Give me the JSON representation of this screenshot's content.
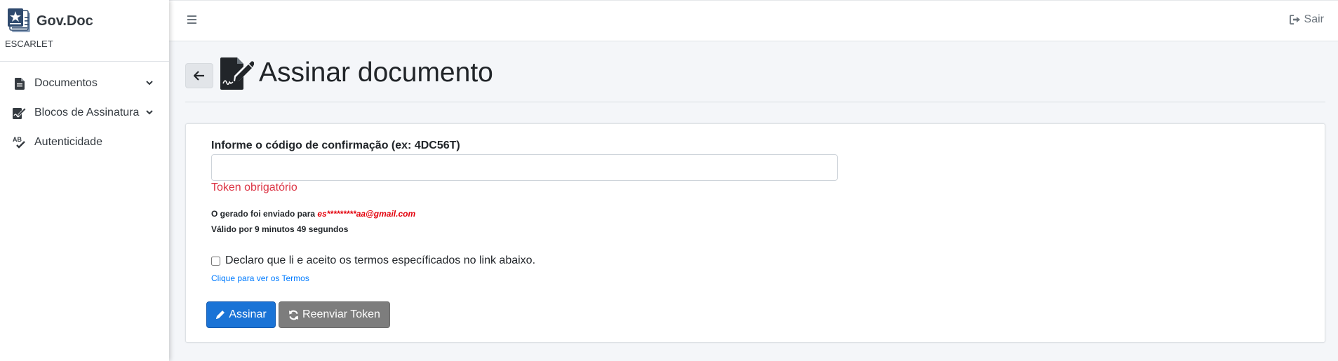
{
  "sidebar": {
    "brand": "Gov.Doc",
    "user": "ESCARLET",
    "items": [
      {
        "label": "Documentos",
        "icon": "file-icon",
        "has_caret": true
      },
      {
        "label": "Blocos de Assinatura",
        "icon": "signature-icon",
        "has_caret": true
      },
      {
        "label": "Autenticidade",
        "icon": "spell-check-icon",
        "has_caret": false
      }
    ]
  },
  "header": {
    "logout_label": "Sair"
  },
  "page": {
    "title": "Assinar documento"
  },
  "form": {
    "label": "Informe o código de confirmação (ex: 4DC56T)",
    "input_value": "",
    "error": "Token obrigatório",
    "sent_prefix": "O gerado foi enviado para",
    "email": "es*********aa@gmail.com",
    "validity": "Válido por 9 minutos 49 segundos",
    "terms_label": "Declaro que li e aceito os termos específicados no link abaixo.",
    "terms_checked": false,
    "terms_link": "Clique para ver os Termos",
    "sign_button": "Assinar",
    "resend_button": "Reenviar Token"
  },
  "colors": {
    "primary": "#1a73d6",
    "secondary": "#7d7d7d",
    "error": "#dc3545",
    "email": "#e3000b",
    "link": "#007bff"
  }
}
